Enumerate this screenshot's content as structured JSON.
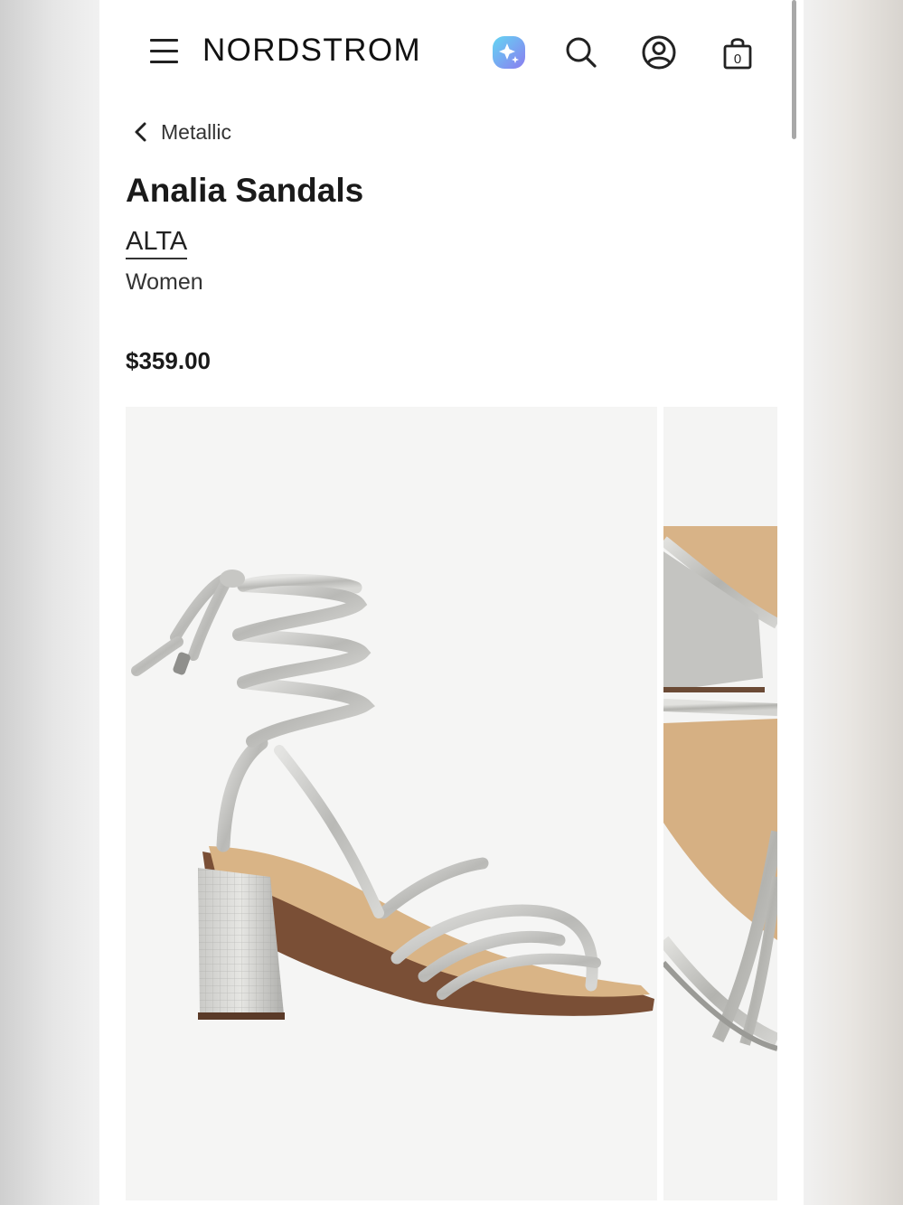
{
  "header": {
    "logo": "NORDSTROM",
    "bag_count": "0",
    "icons": [
      "menu-icon",
      "sparkle-ai-icon",
      "search-icon",
      "account-icon",
      "shopping-bag-icon"
    ]
  },
  "breadcrumb": {
    "label": "Metallic"
  },
  "product": {
    "title": "Analia Sandals",
    "brand": "ALTA",
    "gender": "Women",
    "price": "$359.00"
  },
  "colors": {
    "accent_ai_start": "#5fd2f2",
    "accent_ai_end": "#8a7bf0",
    "text": "#1a1a1a",
    "image_background": "#f5f5f4"
  }
}
